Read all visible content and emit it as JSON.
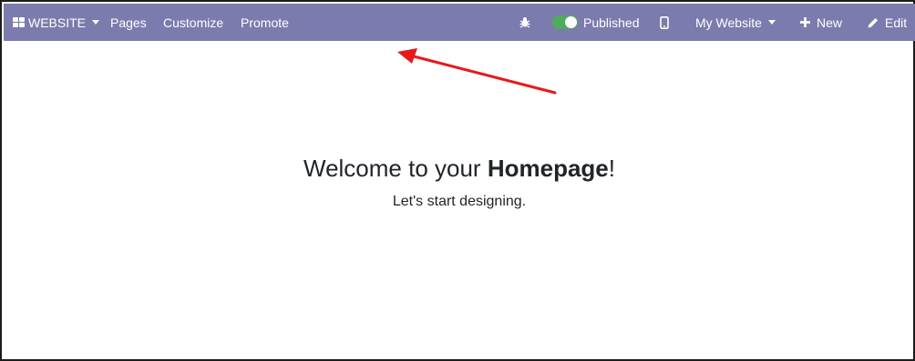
{
  "navbar": {
    "app_menu_label": "WEBSITE",
    "pages_label": "Pages",
    "customize_label": "Customize",
    "promote_label": "Promote",
    "published_label": "Published",
    "website_selector_label": "My Website",
    "new_label": "New",
    "edit_label": "Edit"
  },
  "content": {
    "heading_prefix": "Welcome to your ",
    "heading_bold": "Homepage",
    "heading_suffix": "!",
    "subheading": "Let's start designing."
  },
  "icons": {
    "app_menu": "grid-icon",
    "debug": "bug-icon",
    "published_toggle": "toggle-icon",
    "mobile_preview": "mobile-icon",
    "new": "plus-icon",
    "edit": "pencil-icon"
  },
  "colors": {
    "navbar_bg": "#7c7bad",
    "toggle_on": "#4dad5a",
    "annotation_arrow": "#e8191b"
  }
}
